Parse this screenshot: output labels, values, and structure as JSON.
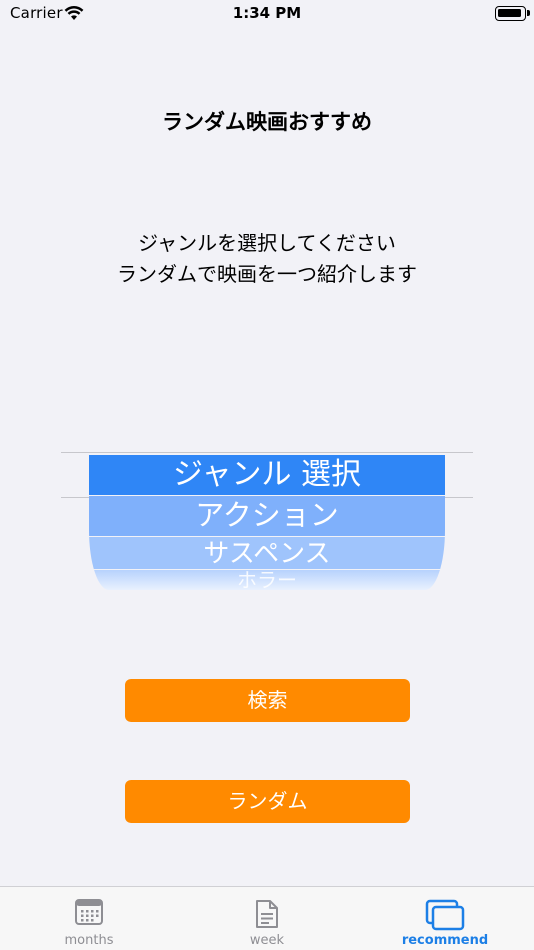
{
  "status_bar": {
    "carrier": "Carrier",
    "time": "1:34 PM"
  },
  "main": {
    "title": "ランダム映画おすすめ",
    "description_line1": "ジャンルを選択してください",
    "description_line2": "ランダムで映画を一つ紹介します"
  },
  "picker": {
    "selected": "ジャンル 選択",
    "options": [
      "アクション",
      "サスペンス",
      "ホラー"
    ]
  },
  "buttons": {
    "search": "検索",
    "random": "ランダム"
  },
  "tabs": [
    {
      "label": "months",
      "icon": "calendar-icon",
      "active": false
    },
    {
      "label": "week",
      "icon": "document-icon",
      "active": false
    },
    {
      "label": "recommend",
      "icon": "cards-icon",
      "active": true
    }
  ],
  "colors": {
    "accent": "#ff8a00",
    "picker_selected": "#2f86f6",
    "tab_active": "#1c7fe6",
    "tab_inactive": "#8e8e93"
  }
}
